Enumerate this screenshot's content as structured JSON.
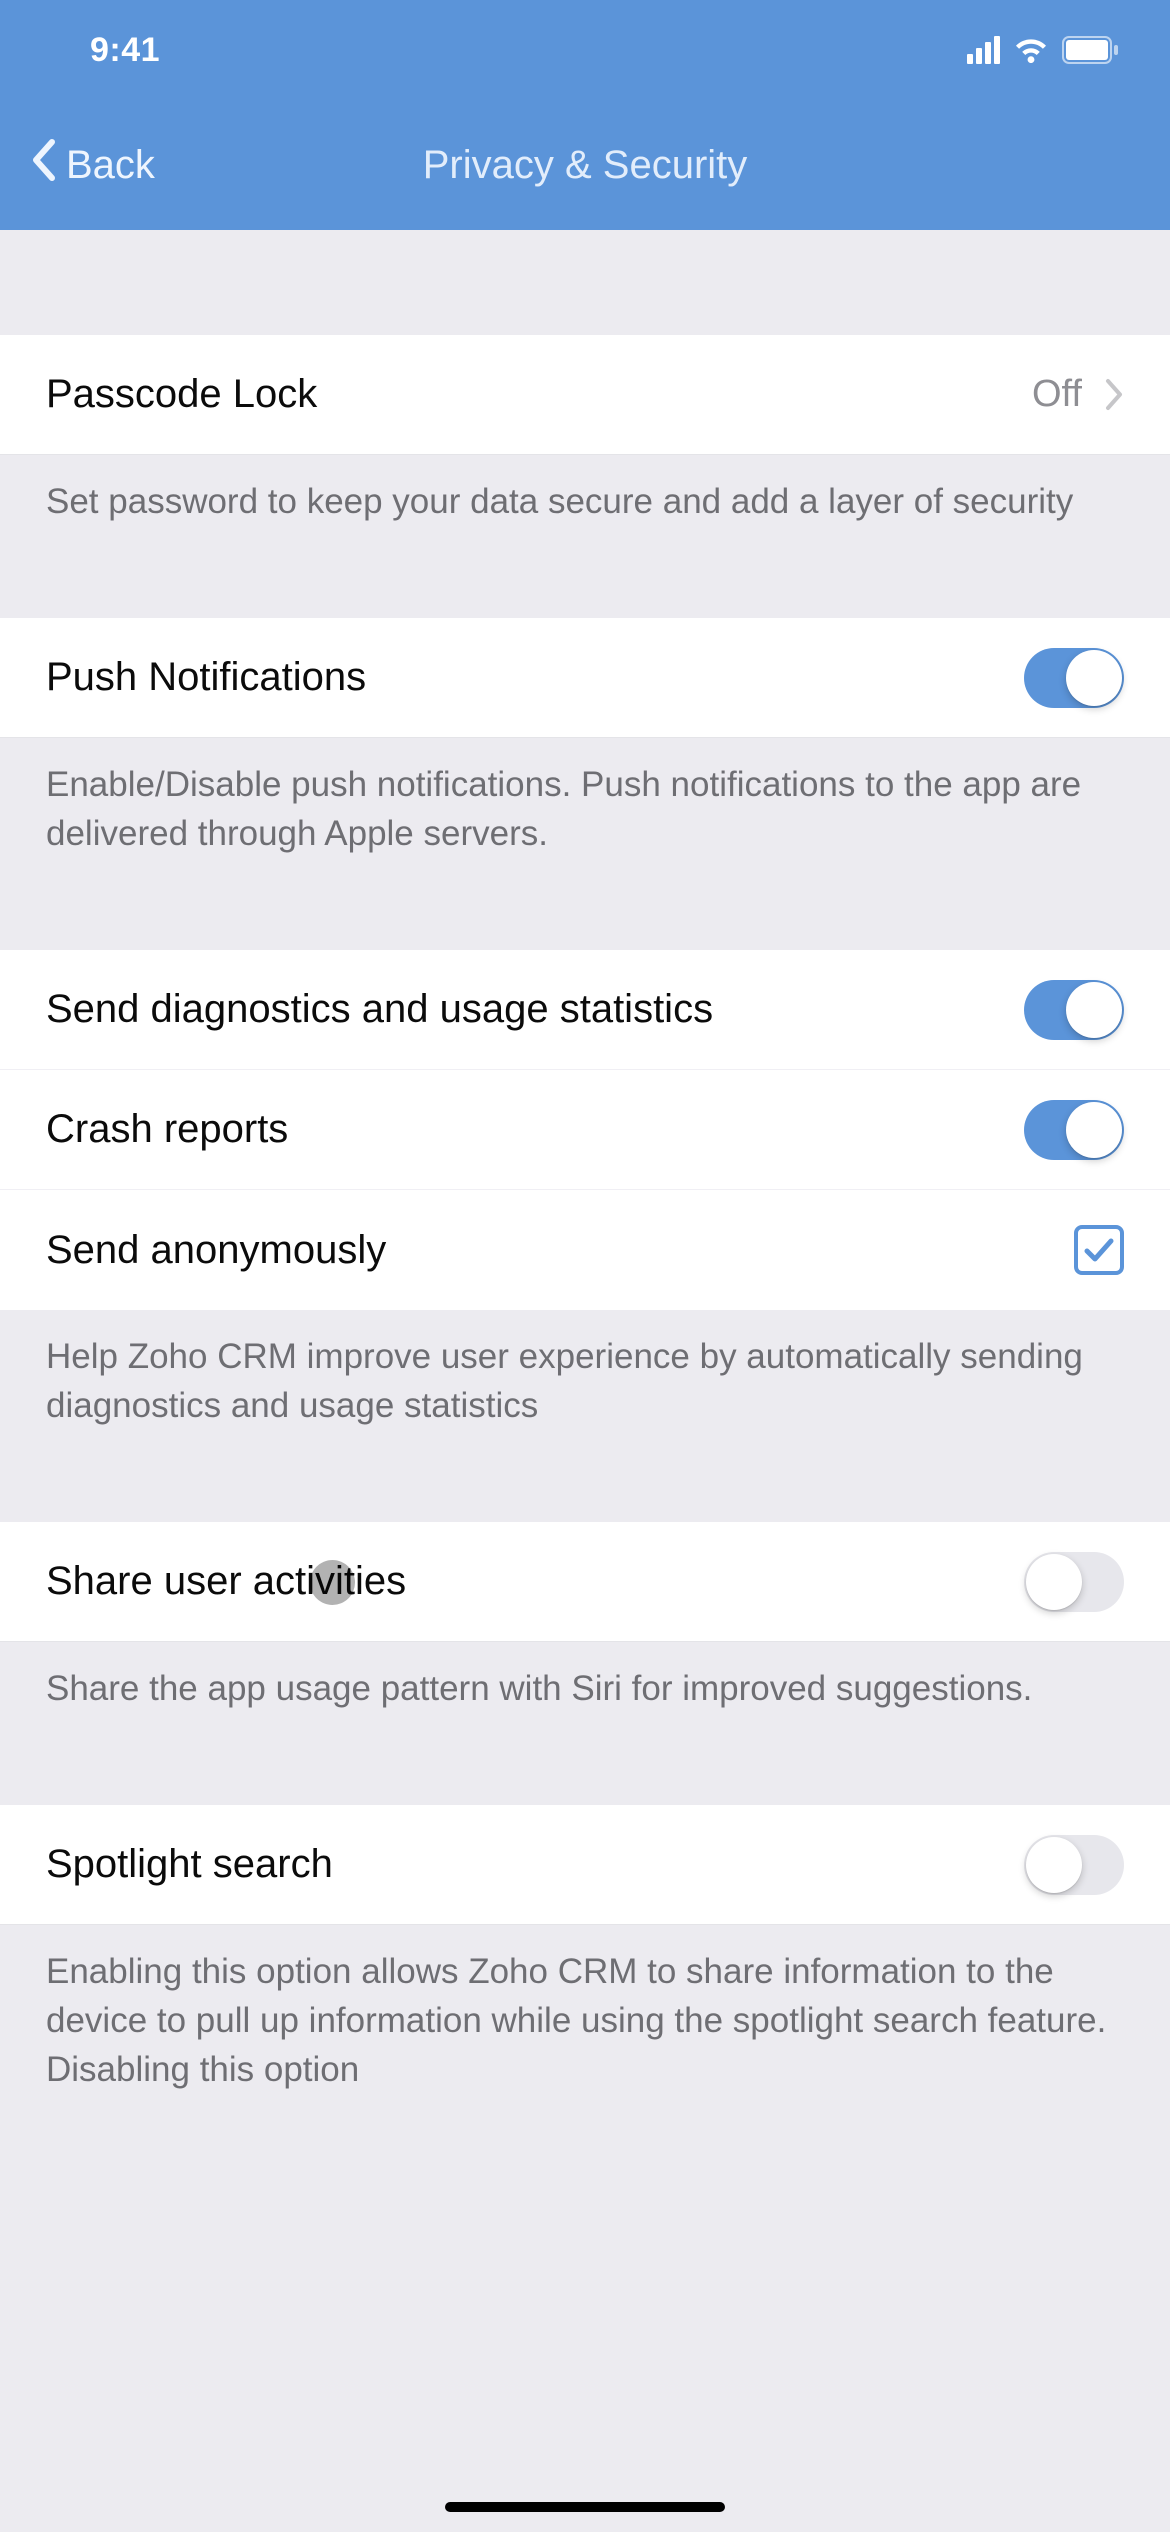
{
  "statusbar": {
    "time": "9:41"
  },
  "nav": {
    "back": "Back",
    "title": "Privacy & Security"
  },
  "passcode": {
    "label": "Passcode Lock",
    "value": "Off",
    "footer": "Set password to keep your data secure and add a layer of security"
  },
  "push": {
    "label": "Push Notifications",
    "on": true,
    "footer": "Enable/Disable push notifications. Push notifications to the app are delivered through Apple servers."
  },
  "diag": {
    "items": [
      {
        "label": "Send diagnostics and usage statistics",
        "type": "toggle",
        "on": true
      },
      {
        "label": "Crash reports",
        "type": "toggle",
        "on": true
      },
      {
        "label": "Send anonymously",
        "type": "checkbox",
        "checked": true
      }
    ],
    "footer": "Help Zoho CRM improve user experience by automatically sending diagnostics and usage statistics"
  },
  "share": {
    "label": "Share user activities",
    "on": false,
    "footer": "Share the app usage pattern with Siri for improved suggestions."
  },
  "spotlight": {
    "label": "Spotlight search",
    "on": false,
    "footer": "Enabling this option allows Zoho CRM to share information to the device to pull up information while using the spotlight search feature. Disabling this option"
  }
}
